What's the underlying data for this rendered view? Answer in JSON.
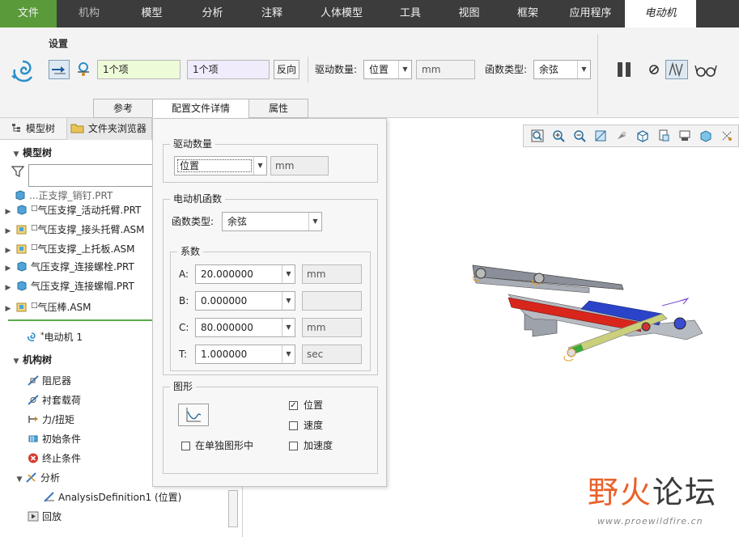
{
  "menu": {
    "tabs": [
      {
        "label": "文件"
      },
      {
        "label": "机构"
      },
      {
        "label": "模型"
      },
      {
        "label": "分析"
      },
      {
        "label": "注释"
      },
      {
        "label": "人体模型"
      },
      {
        "label": "工具"
      },
      {
        "label": "视图"
      },
      {
        "label": "框架"
      },
      {
        "label": "应用程序"
      },
      {
        "label": "电动机"
      }
    ]
  },
  "ribbon": {
    "group_label": "设置",
    "collector1": "1个项",
    "collector2": "1个项",
    "reverse_label": "反向",
    "drive_qty_label": "驱动数量:",
    "drive_qty_value": "位置",
    "drive_unit": "mm",
    "func_type_label": "函数类型:",
    "func_type_value": "余弦",
    "subtabs": [
      {
        "label": "参考"
      },
      {
        "label": "配置文件详情"
      },
      {
        "label": "属性"
      }
    ]
  },
  "left_pane": {
    "tab_model_tree": "模型树",
    "tab_folder_browser": "文件夹浏览器",
    "section_model_tree": "模型树",
    "items": [
      {
        "label": "...正支撑_销钉.PRT"
      },
      {
        "label": "气压支撑_活动托臂.PRT"
      },
      {
        "label": "气压支撑_接头托臂.ASM"
      },
      {
        "label": "气压支撑_上托板.ASM"
      },
      {
        "label": "气压支撑_连接螺栓.PRT"
      },
      {
        "label": "气压支撑_连接螺帽.PRT"
      },
      {
        "label": "气压棒.ASM"
      }
    ],
    "motor_item": "电动机 1",
    "section_mech_tree": "机构树",
    "mech_items": [
      {
        "label": "阻尼器"
      },
      {
        "label": "衬套载荷"
      },
      {
        "label": "力/扭矩"
      },
      {
        "label": "初始条件"
      },
      {
        "label": "终止条件"
      },
      {
        "label": "分析"
      },
      {
        "label": "AnalysisDefinition1 (位置)"
      },
      {
        "label": "回放"
      }
    ]
  },
  "popup": {
    "drive_qty_title": "驱动数量",
    "drive_qty_value": "位置",
    "drive_unit": "mm",
    "motor_func_title": "电动机函数",
    "func_type_label": "函数类型:",
    "func_type_value": "余弦",
    "coef_title": "系数",
    "coefs": [
      {
        "label": "A:",
        "value": "20.000000",
        "unit": "mm"
      },
      {
        "label": "B:",
        "value": "0.000000",
        "unit": ""
      },
      {
        "label": "C:",
        "value": "80.000000",
        "unit": "mm"
      },
      {
        "label": "T:",
        "value": "1.000000",
        "unit": "sec"
      }
    ],
    "graph_title": "图形",
    "separate_graph_label": "在单独图形中",
    "cb_position": "位置",
    "cb_velocity": "速度",
    "cb_acceleration": "加速度"
  },
  "watermark": {
    "text_a": "野火",
    "text_b": "论坛",
    "url": "www.proewildfire.cn"
  },
  "colors": {
    "file_tab": "#5a9a3a",
    "menu_bg": "#3c3c3c",
    "tree_green": "#5aa84a"
  }
}
